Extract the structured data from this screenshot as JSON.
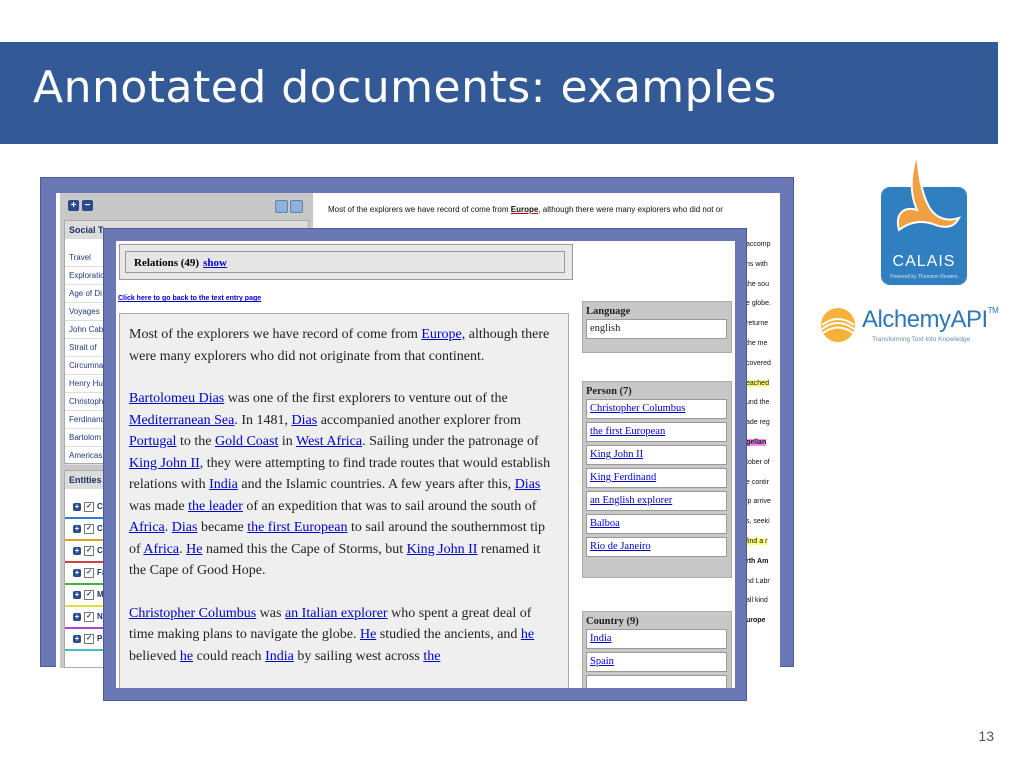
{
  "slide": {
    "title": "Annotated documents: examples",
    "page_number": "13"
  },
  "back_screenshot": {
    "social_tags": {
      "header": "Social T",
      "items": [
        "Travel",
        "Exploratio",
        "Age of Di",
        "Voyages",
        "John Cab",
        "Strait of",
        "Circumna",
        "Henry Hu",
        "Christoph",
        "Ferdinand",
        "Bartolom",
        "Americas"
      ]
    },
    "entities": {
      "header": "Entities",
      "rows": [
        {
          "label": "Ci",
          "underline": "#2a7de1"
        },
        {
          "label": "Co",
          "underline": "#e0a020"
        },
        {
          "label": "Co",
          "underline": "#d04040"
        },
        {
          "label": "Fa",
          "underline": "#40b040"
        },
        {
          "label": "Mi",
          "underline": "#e0e040"
        },
        {
          "label": "Na",
          "underline": "#b040d0"
        },
        {
          "label": "Pe",
          "underline": "#40c0c0"
        }
      ]
    },
    "text_line": {
      "prefix": "Most of the explorers we have record of come from ",
      "highlight": "Europe",
      "suffix": ", although there were many explorers who did not or"
    },
    "right_fragments": [
      "accomp",
      "ns with",
      "the sou",
      "e globe.",
      "returne",
      "the me",
      "covered",
      "eached",
      "und the",
      "ade reg",
      "gellan",
      "tober of",
      "e contir",
      "ip arrive",
      "s, seeki",
      "find a r",
      "rth Am",
      "nd Labr",
      "all kind",
      "urope"
    ]
  },
  "front_screenshot": {
    "relations_label": "Relations (49)",
    "relations_show": "show",
    "back_link": "Click here to go back to the text entry page",
    "paragraph1": {
      "a": "Most of the explorers we have record of come from ",
      "link1": "Europe,",
      "b": " although there were many explorers who did not originate from that continent."
    },
    "paragraph2": {
      "l_bartolomeu": "Bartolomeu Dias",
      "t1": " was one of the first explorers to venture out of the ",
      "l_med": "Mediterranean Sea",
      "t2": ". In 1481, ",
      "l_dias1": "Dias",
      "t3": " accompanied another explorer from ",
      "l_portugal": "Portugal",
      "t4": " to the ",
      "l_gold": "Gold Coast",
      "t5": " in ",
      "l_westafrica": "West Africa",
      "t6": ". Sailing under the patronage of ",
      "l_king1": "King John II,",
      "t7": " they were attempting to find trade routes that would establish relations with ",
      "l_india1": "India",
      "t8": " and the Islamic countries. A few years after this, ",
      "l_dias2": "Dias",
      "t9": " was made ",
      "l_leader": "the leader",
      "t10": " of an expedition that was to sail around the south of ",
      "l_africa1": "Africa",
      "t11": ". ",
      "l_dias3": "Dias",
      "t12": " became ",
      "l_first": "the first European",
      "t13": " to sail around the southernmost tip of ",
      "l_africa2": "Africa",
      "t14": ". ",
      "l_he1": "He",
      "t15": " named this the Cape of Storms, but ",
      "l_king2": "King John II",
      "t16": " renamed it the Cape of Good Hope."
    },
    "paragraph3": {
      "l_columbus": "Christopher Columbus",
      "t1": " was ",
      "l_italian": "an Italian explorer",
      "t2": " who spent a great deal of time making plans to navigate the globe. ",
      "l_he2": "He",
      "t3": " studied the ancients, and ",
      "l_he3": "he",
      "t4": " believed ",
      "l_he4": "he",
      "t5": " could reach ",
      "l_india2": "India",
      "t6": " by sailing west across ",
      "l_the": "the"
    },
    "language": {
      "title": "Language",
      "value": "english"
    },
    "person": {
      "title": "Person (7)",
      "items": [
        "Christopher Columbus",
        "the first European",
        "King John II",
        "King Ferdinand",
        "an English explorer",
        "Balboa",
        "Rio de Janeiro"
      ]
    },
    "country": {
      "title": "Country (9)",
      "items": [
        "India",
        "Spain"
      ]
    }
  },
  "logos": {
    "calais_name": "CALAIS",
    "calais_sub": "Powered by Thomson Reuters",
    "alchemy_name": "AlchemyAPI",
    "alchemy_tm": "TM",
    "alchemy_sub": "Transforming Text Into Knowledge"
  }
}
